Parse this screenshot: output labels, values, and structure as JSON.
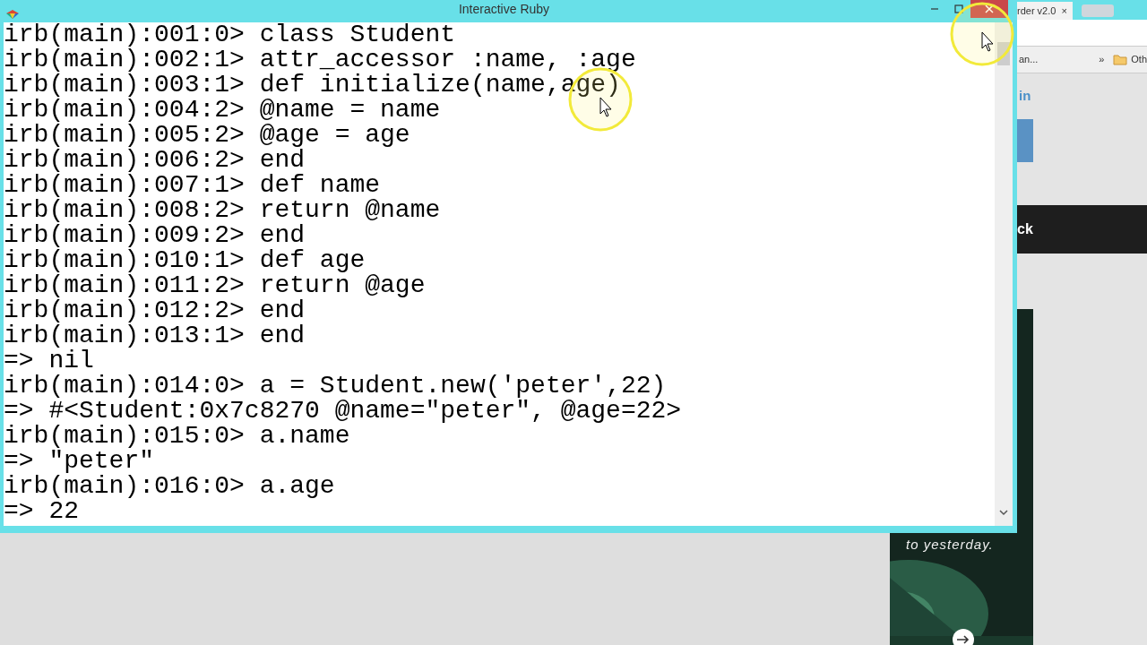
{
  "window": {
    "title": "Interactive Ruby"
  },
  "console": {
    "lines": [
      "irb(main):001:0> class Student",
      "irb(main):002:1> attr_accessor :name, :age",
      "irb(main):003:1> def initialize(name,age)",
      "irb(main):004:2> @name = name",
      "irb(main):005:2> @age = age",
      "irb(main):006:2> end",
      "irb(main):007:1> def name",
      "irb(main):008:2> return @name",
      "irb(main):009:2> end",
      "irb(main):010:1> def age",
      "irb(main):011:2> return @age",
      "irb(main):012:2> end",
      "irb(main):013:1> end",
      "=> nil",
      "irb(main):014:0> a = Student.new('peter',22)",
      "=> #<Student:0x7c8270 @name=\"peter\", @age=22>",
      "irb(main):015:0> a.name",
      "=> \"peter\"",
      "irb(main):016:0> a.age",
      "=> 22"
    ]
  },
  "browser": {
    "tab": {
      "title": "rder v2.0",
      "close": "×"
    },
    "bookmarks": [
      {
        "kind": "link",
        "label": "an..."
      },
      {
        "kind": "more",
        "label": "»"
      },
      {
        "kind": "folder",
        "label": "Oth"
      }
    ],
    "link": "in",
    "banner": "ck",
    "promo": {
      "text": "to yesterday."
    }
  }
}
